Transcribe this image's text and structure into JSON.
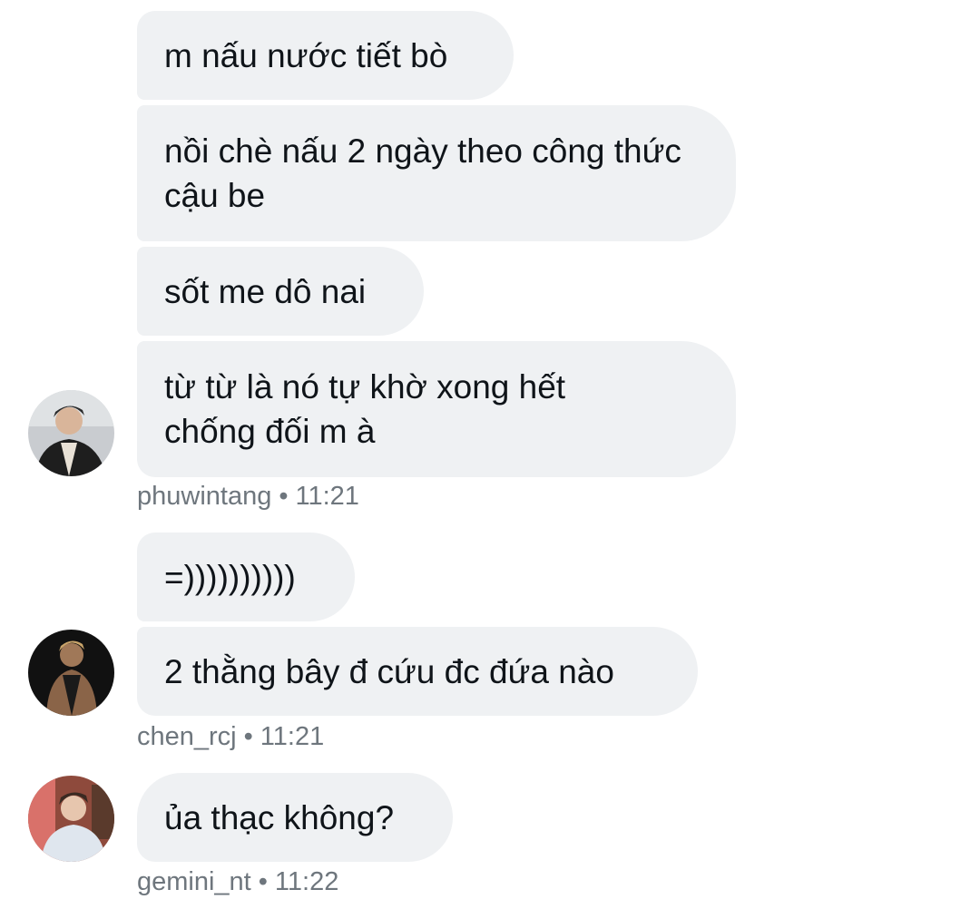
{
  "conversation": {
    "groups": [
      {
        "user": "phuwintang",
        "time": "11:21",
        "avatar_icon": "user-avatar-photo",
        "messages": [
          "m nấu nước tiết bò",
          "nồi chè nấu 2 ngày theo công thức cậu be",
          "sốt me dô nai",
          "từ từ là nó tự khờ xong hết chống đối m à"
        ]
      },
      {
        "user": "chen_rcj",
        "time": "11:21",
        "avatar_icon": "user-avatar-photo",
        "messages": [
          "=))))))))))",
          "2 thằng bây đ cứu đc đứa nào"
        ]
      },
      {
        "user": "gemini_nt",
        "time": "11:22",
        "avatar_icon": "user-avatar-photo",
        "messages": [
          "ủa thạc không?"
        ]
      }
    ],
    "separator": "•"
  },
  "colors": {
    "bubble_bg": "#eff1f3",
    "text": "#0f1419",
    "meta_text": "#6e767d",
    "background": "#ffffff"
  }
}
